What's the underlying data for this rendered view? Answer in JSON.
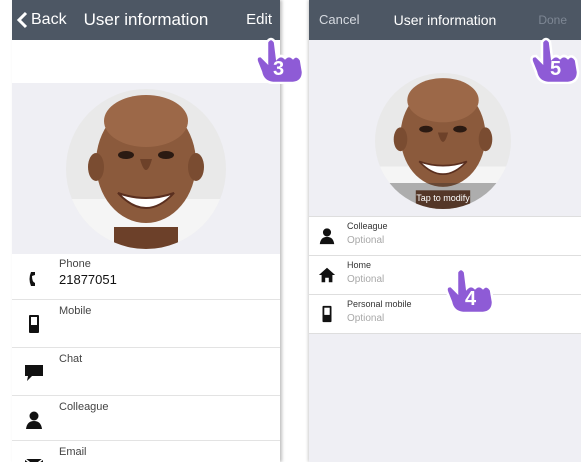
{
  "left_screen": {
    "nav": {
      "back_label": "Back",
      "title": "User information",
      "edit_label": "Edit"
    },
    "rows": [
      {
        "label": "Phone",
        "value": "21877051",
        "icon": "phone-icon"
      },
      {
        "label": "Mobile",
        "value": "",
        "icon": "mobile-icon"
      },
      {
        "label": "Chat",
        "value": "",
        "icon": "chat-icon"
      },
      {
        "label": "Colleague",
        "value": "",
        "icon": "person-icon"
      },
      {
        "label": "Email",
        "value": "",
        "icon": "mail-icon"
      }
    ]
  },
  "right_screen": {
    "nav": {
      "cancel_label": "Cancel",
      "title": "User information",
      "done_label": "Done"
    },
    "photo_caption": "Tap to modify",
    "rows": [
      {
        "label": "Colleague",
        "placeholder": "Optional",
        "icon": "person-icon"
      },
      {
        "label": "Home",
        "placeholder": "Optional",
        "icon": "home-icon"
      },
      {
        "label": "Personal mobile",
        "placeholder": "Optional",
        "icon": "mobile-icon"
      }
    ]
  },
  "callouts": {
    "step_3": "3",
    "step_4": "4",
    "step_5": "5"
  },
  "colors": {
    "nav_bg": "#4d5764",
    "callout_fill": "#8e5bd6",
    "group_bg": "#efeff4"
  }
}
